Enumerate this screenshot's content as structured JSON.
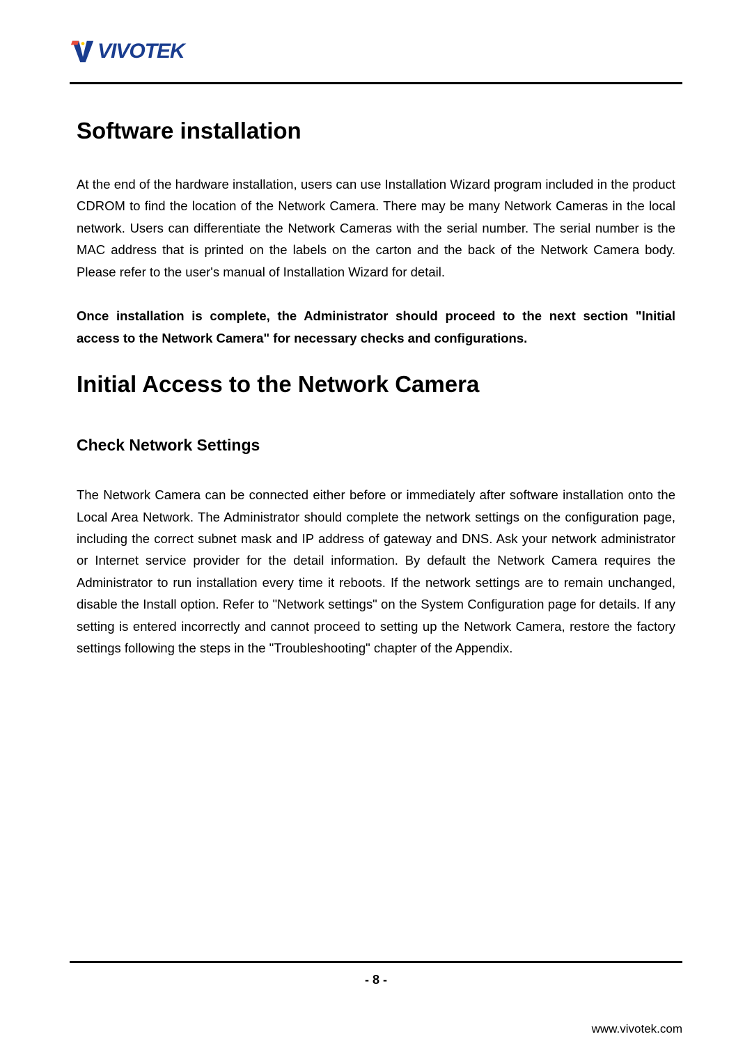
{
  "logo": {
    "brand": "VIV",
    "brand_mid": "O",
    "brand_end": "TEK"
  },
  "sections": {
    "h1": "Software installation",
    "p1": "At the end of the hardware installation, users can use Installation Wizard program included in the product CDROM to find the location of the Network Camera. There may be many Network Cameras in the local network. Users can differentiate the Network Cameras with the serial number. The serial number is the MAC address that is printed on the labels on the carton and the back of the Network Camera body. Please refer to the user's manual of Installation Wizard for detail.",
    "p2": "Once installation is complete, the Administrator should proceed to the next section \"Initial access to the Network Camera\" for necessary checks and configurations.",
    "h2": "Initial Access to the Network Camera",
    "h3": "Check Network Settings",
    "p3": "The Network Camera can be connected either before or immediately after software installation onto the Local Area Network. The Administrator should complete the network settings on the configuration page, including the correct subnet mask and IP address of gateway and DNS. Ask your network administrator or Internet service provider for the detail information. By default the Network Camera requires the Administrator to run installation every time it reboots. If the network settings are to remain unchanged, disable the Install option. Refer to \"Network settings\" on the System Configuration page for details. If any setting is entered incorrectly and cannot proceed to setting up the Network Camera, restore the factory settings following the steps in the \"Troubleshooting\" chapter of the Appendix."
  },
  "footer": {
    "page_number": "- 8 -",
    "website": "www.vivotek.com"
  }
}
